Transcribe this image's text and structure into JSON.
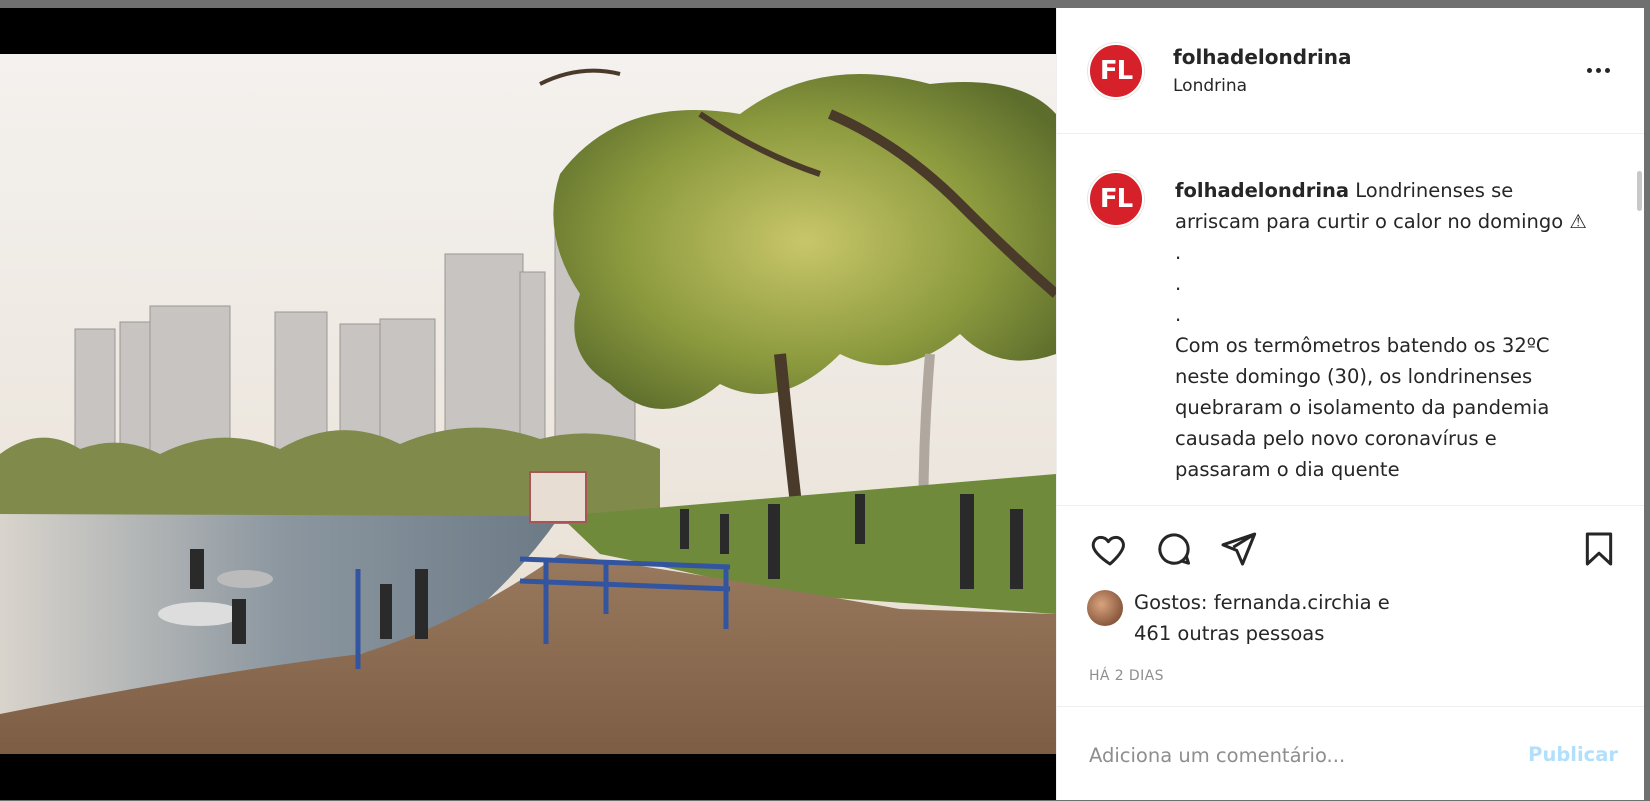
{
  "post": {
    "username": "folhadelondrina",
    "location": "Londrina",
    "avatar_text": "FL",
    "caption": {
      "username": "folhadelondrina",
      "first_line": "Londrinenses se arriscam para curtir o calor no domingo ⚠",
      "dots": [
        ".",
        ".",
        "."
      ],
      "body": "Com os termômetros batendo os 32ºC neste domingo (30), os londrinenses quebraram o isolamento da pandemia causada pelo novo coronavírus e passaram o dia quente"
    },
    "likes": {
      "text_line1": "Gostos: fernanda.circhia e",
      "text_line2": "461 outras pessoas"
    },
    "time_ago": "HÁ 2 DIAS",
    "comment": {
      "placeholder": "Adiciona um comentário...",
      "publish_label": "Publicar"
    }
  },
  "icons": {
    "more": "more-options-icon",
    "like": "heart-icon",
    "comment": "comment-icon",
    "share": "paper-plane-icon",
    "save": "bookmark-icon"
  },
  "colors": {
    "brand_red": "#d6202a",
    "publish_disabled": "#b2dffc",
    "muted_text": "#8e8e8e"
  }
}
